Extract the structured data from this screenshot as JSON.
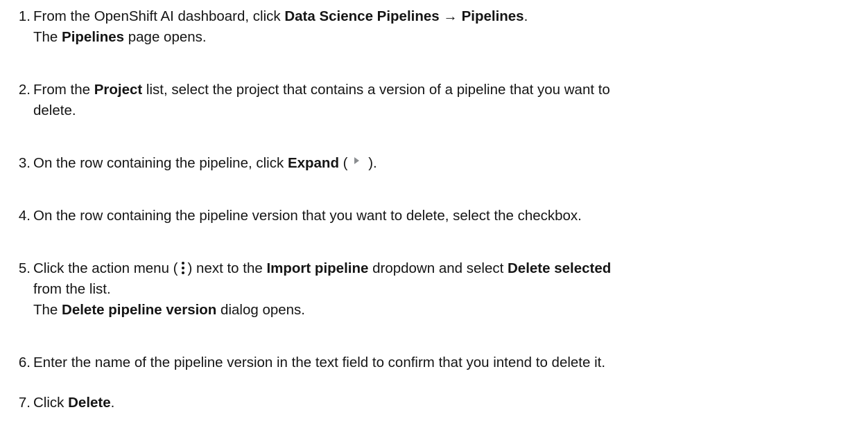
{
  "steps": [
    {
      "number": "1.",
      "lines": [
        {
          "t1": "From the OpenShift AI dashboard, click ",
          "b1": "Data Science Pipelines",
          "t2": " → ",
          "b2": "Pipelines",
          "t3": "."
        },
        {
          "t1": "The ",
          "b1": "Pipelines",
          "t2": " page opens."
        }
      ]
    },
    {
      "number": "2.",
      "lines": [
        {
          "t1": "From the ",
          "b1": "Project",
          "t2": " list, select the project that contains a version of a pipeline that you want to"
        },
        {
          "t1": "delete."
        }
      ]
    },
    {
      "number": "3.",
      "lines": [
        {
          "t1": "On the row containing the pipeline, click ",
          "b1": "Expand",
          "t2": " (",
          "icon": "expand-chevron-icon",
          "t3": " )."
        }
      ]
    },
    {
      "number": "4.",
      "lines": [
        {
          "t1": "On the row containing the pipeline version that you want to delete, select the checkbox."
        }
      ]
    },
    {
      "number": "5.",
      "lines": [
        {
          "t1": "Click the action menu (",
          "icon": "kebab-menu-icon",
          "t2": ") next to the ",
          "b1": "Import pipeline",
          "t3": " dropdown and select ",
          "b2": "Delete selected"
        },
        {
          "t1": "from the list."
        },
        {
          "t1": "The ",
          "b1": "Delete pipeline version",
          "t2": " dialog opens."
        }
      ]
    },
    {
      "number": "6.",
      "lines": [
        {
          "t1": "Enter the name of the pipeline version in the text field to confirm that you intend to delete it."
        }
      ]
    },
    {
      "number": "7.",
      "lines": [
        {
          "t1": "Click ",
          "b1": "Delete",
          "t2": "."
        }
      ]
    }
  ],
  "colors": {
    "text": "#151515",
    "icon_grey": "#8a8d90"
  }
}
